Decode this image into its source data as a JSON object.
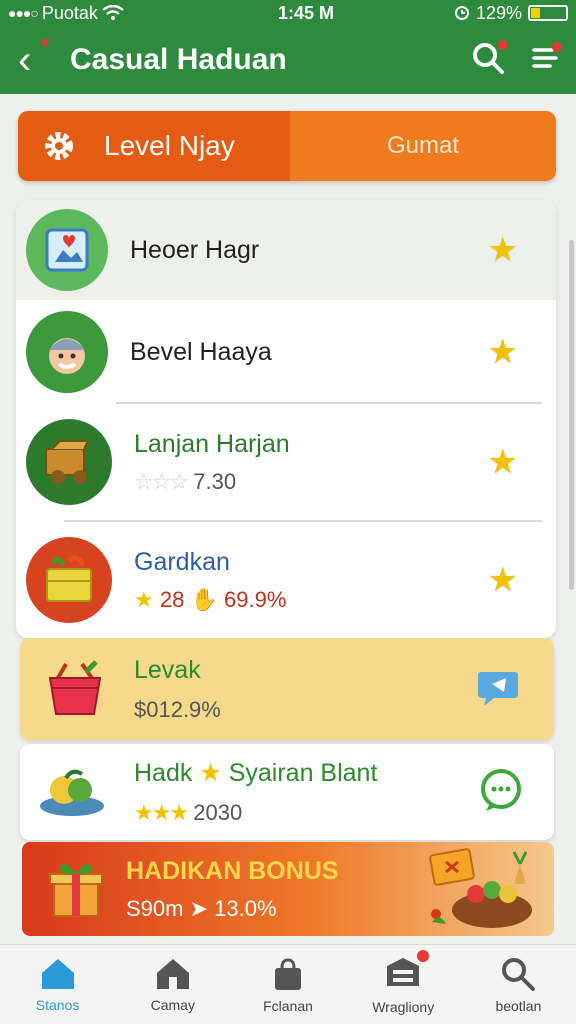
{
  "status_bar": {
    "carrier": "Puotak",
    "time": "1:45 M",
    "battery": "129%",
    "battery_level": 0.25
  },
  "app_bar": {
    "title": "Casual Haduan"
  },
  "segment": {
    "tab_active": "Level Njay",
    "tab_inactive": "Gumat"
  },
  "list": [
    {
      "name": "Heoer Hagr",
      "sub": ""
    },
    {
      "name": "Bevel Haaya",
      "sub": ""
    },
    {
      "name": "Lanjan Harjan",
      "sub": "7.30",
      "rating_stars": 3
    },
    {
      "name": "Gardkan",
      "sub_num": "28",
      "sub_pct": "69.9%"
    }
  ],
  "cards": [
    {
      "name": "Levak",
      "sub": "$012.9%"
    },
    {
      "name": "Hadk",
      "name2": "Syairan Blant",
      "sub": "2030"
    }
  ],
  "bonus": {
    "title": "HADIKAN BONUS",
    "sub_a": "S90m",
    "sub_b": "13.0%"
  },
  "nav": [
    {
      "label": "Stanos"
    },
    {
      "label": "Camay"
    },
    {
      "label": "Fclanan"
    },
    {
      "label": "Wragliony"
    },
    {
      "label": "beotlan"
    }
  ],
  "colors": {
    "primary": "#2e8b3e",
    "orange": "#f07b1e",
    "orange_dark": "#e45c12",
    "star": "#f2c200",
    "nav_active": "#2a9bd8"
  }
}
